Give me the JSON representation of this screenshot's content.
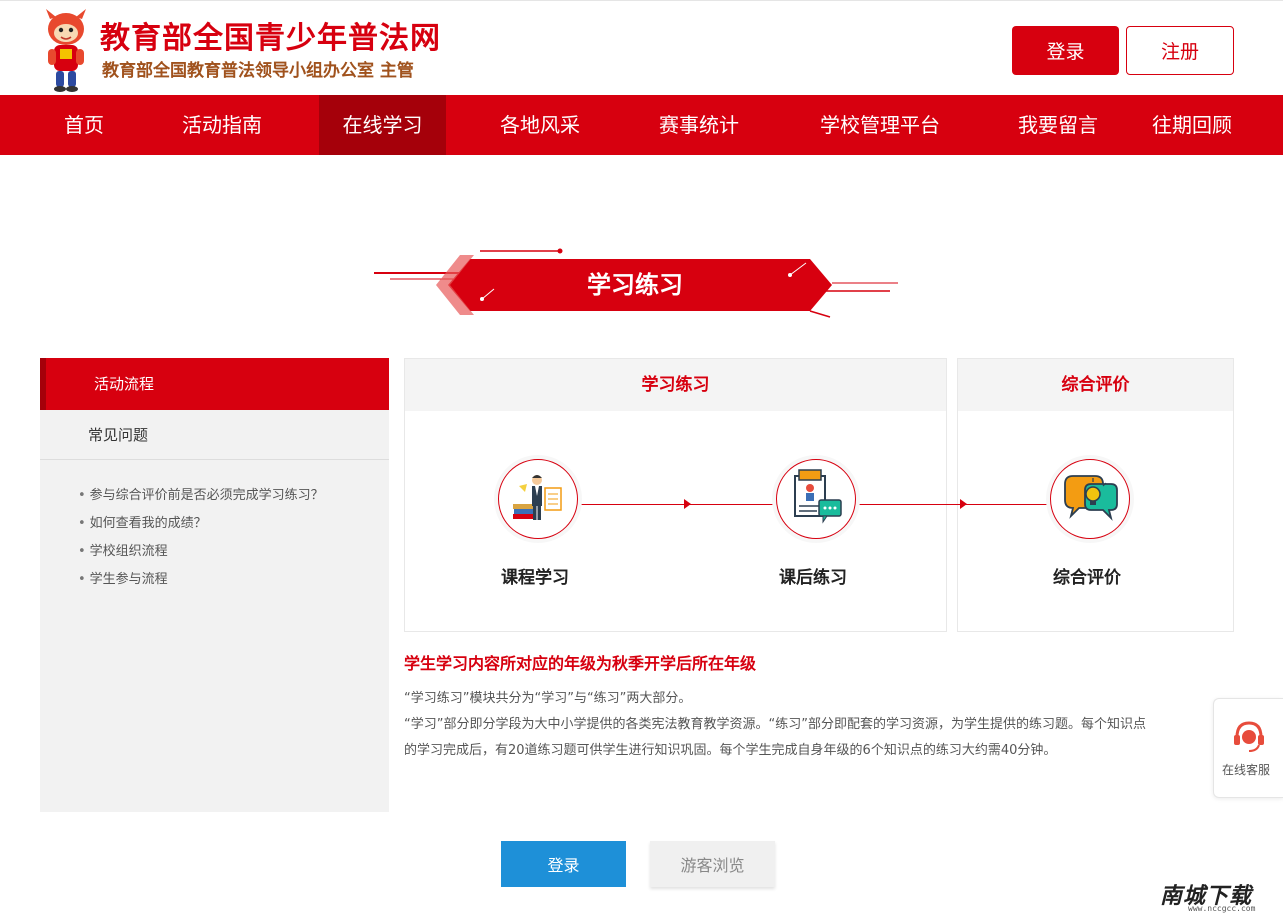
{
  "header": {
    "title": "教育部全国青少年普法网",
    "subtitle": "教育部全国教育普法领导小组办公室 主管",
    "login_label": "登录",
    "register_label": "注册"
  },
  "nav": {
    "items": [
      {
        "label": "首页"
      },
      {
        "label": "活动指南"
      },
      {
        "label": "在线学习"
      },
      {
        "label": "各地风采"
      },
      {
        "label": "赛事统计"
      },
      {
        "label": "学校管理平台"
      },
      {
        "label": "我要留言"
      },
      {
        "label": "往期回顾"
      }
    ],
    "active": "在线学习"
  },
  "banner": {
    "title": "学习练习"
  },
  "sidebar": {
    "tabs": [
      {
        "label": "活动流程"
      },
      {
        "label": "常见问题"
      }
    ],
    "faq": [
      "参与综合评价前是否必须完成学习练习？",
      "如何查看我的成绩？",
      "学校组织流程",
      "学生参与流程"
    ]
  },
  "flow": {
    "study_box_title": "学习练习",
    "eval_box_title": "综合评价",
    "steps": [
      {
        "label": "课程学习",
        "icon": "teacher-icon"
      },
      {
        "label": "课后练习",
        "icon": "document-icon"
      },
      {
        "label": "综合评价",
        "icon": "idea-chat-icon"
      }
    ]
  },
  "info": {
    "title": "学生学习内容所对应的年级为秋季开学后所在年级",
    "paragraphs": [
      "“学习练习”模块共分为“学习”与“练习”两大部分。",
      "“学习”部分即分学段为大中小学提供的各类宪法教育教学资源。“练习”部分即配套的学习资源，为学生提供的练习题。每个知识点",
      "的学习完成后，有20道练习题可供学生进行知识巩固。每个学生完成自身年级的6个知识点的练习大约需40分钟。"
    ]
  },
  "actions": {
    "login_label": "登录",
    "guest_label": "游客浏览"
  },
  "service": {
    "label": "在线客服"
  },
  "watermark": {
    "text": "南城下载",
    "sub": "www.nccgcc.com"
  },
  "colors": {
    "brand_red": "#d7000f",
    "dark_red": "#a5000a",
    "login_blue": "#1e90d8"
  }
}
